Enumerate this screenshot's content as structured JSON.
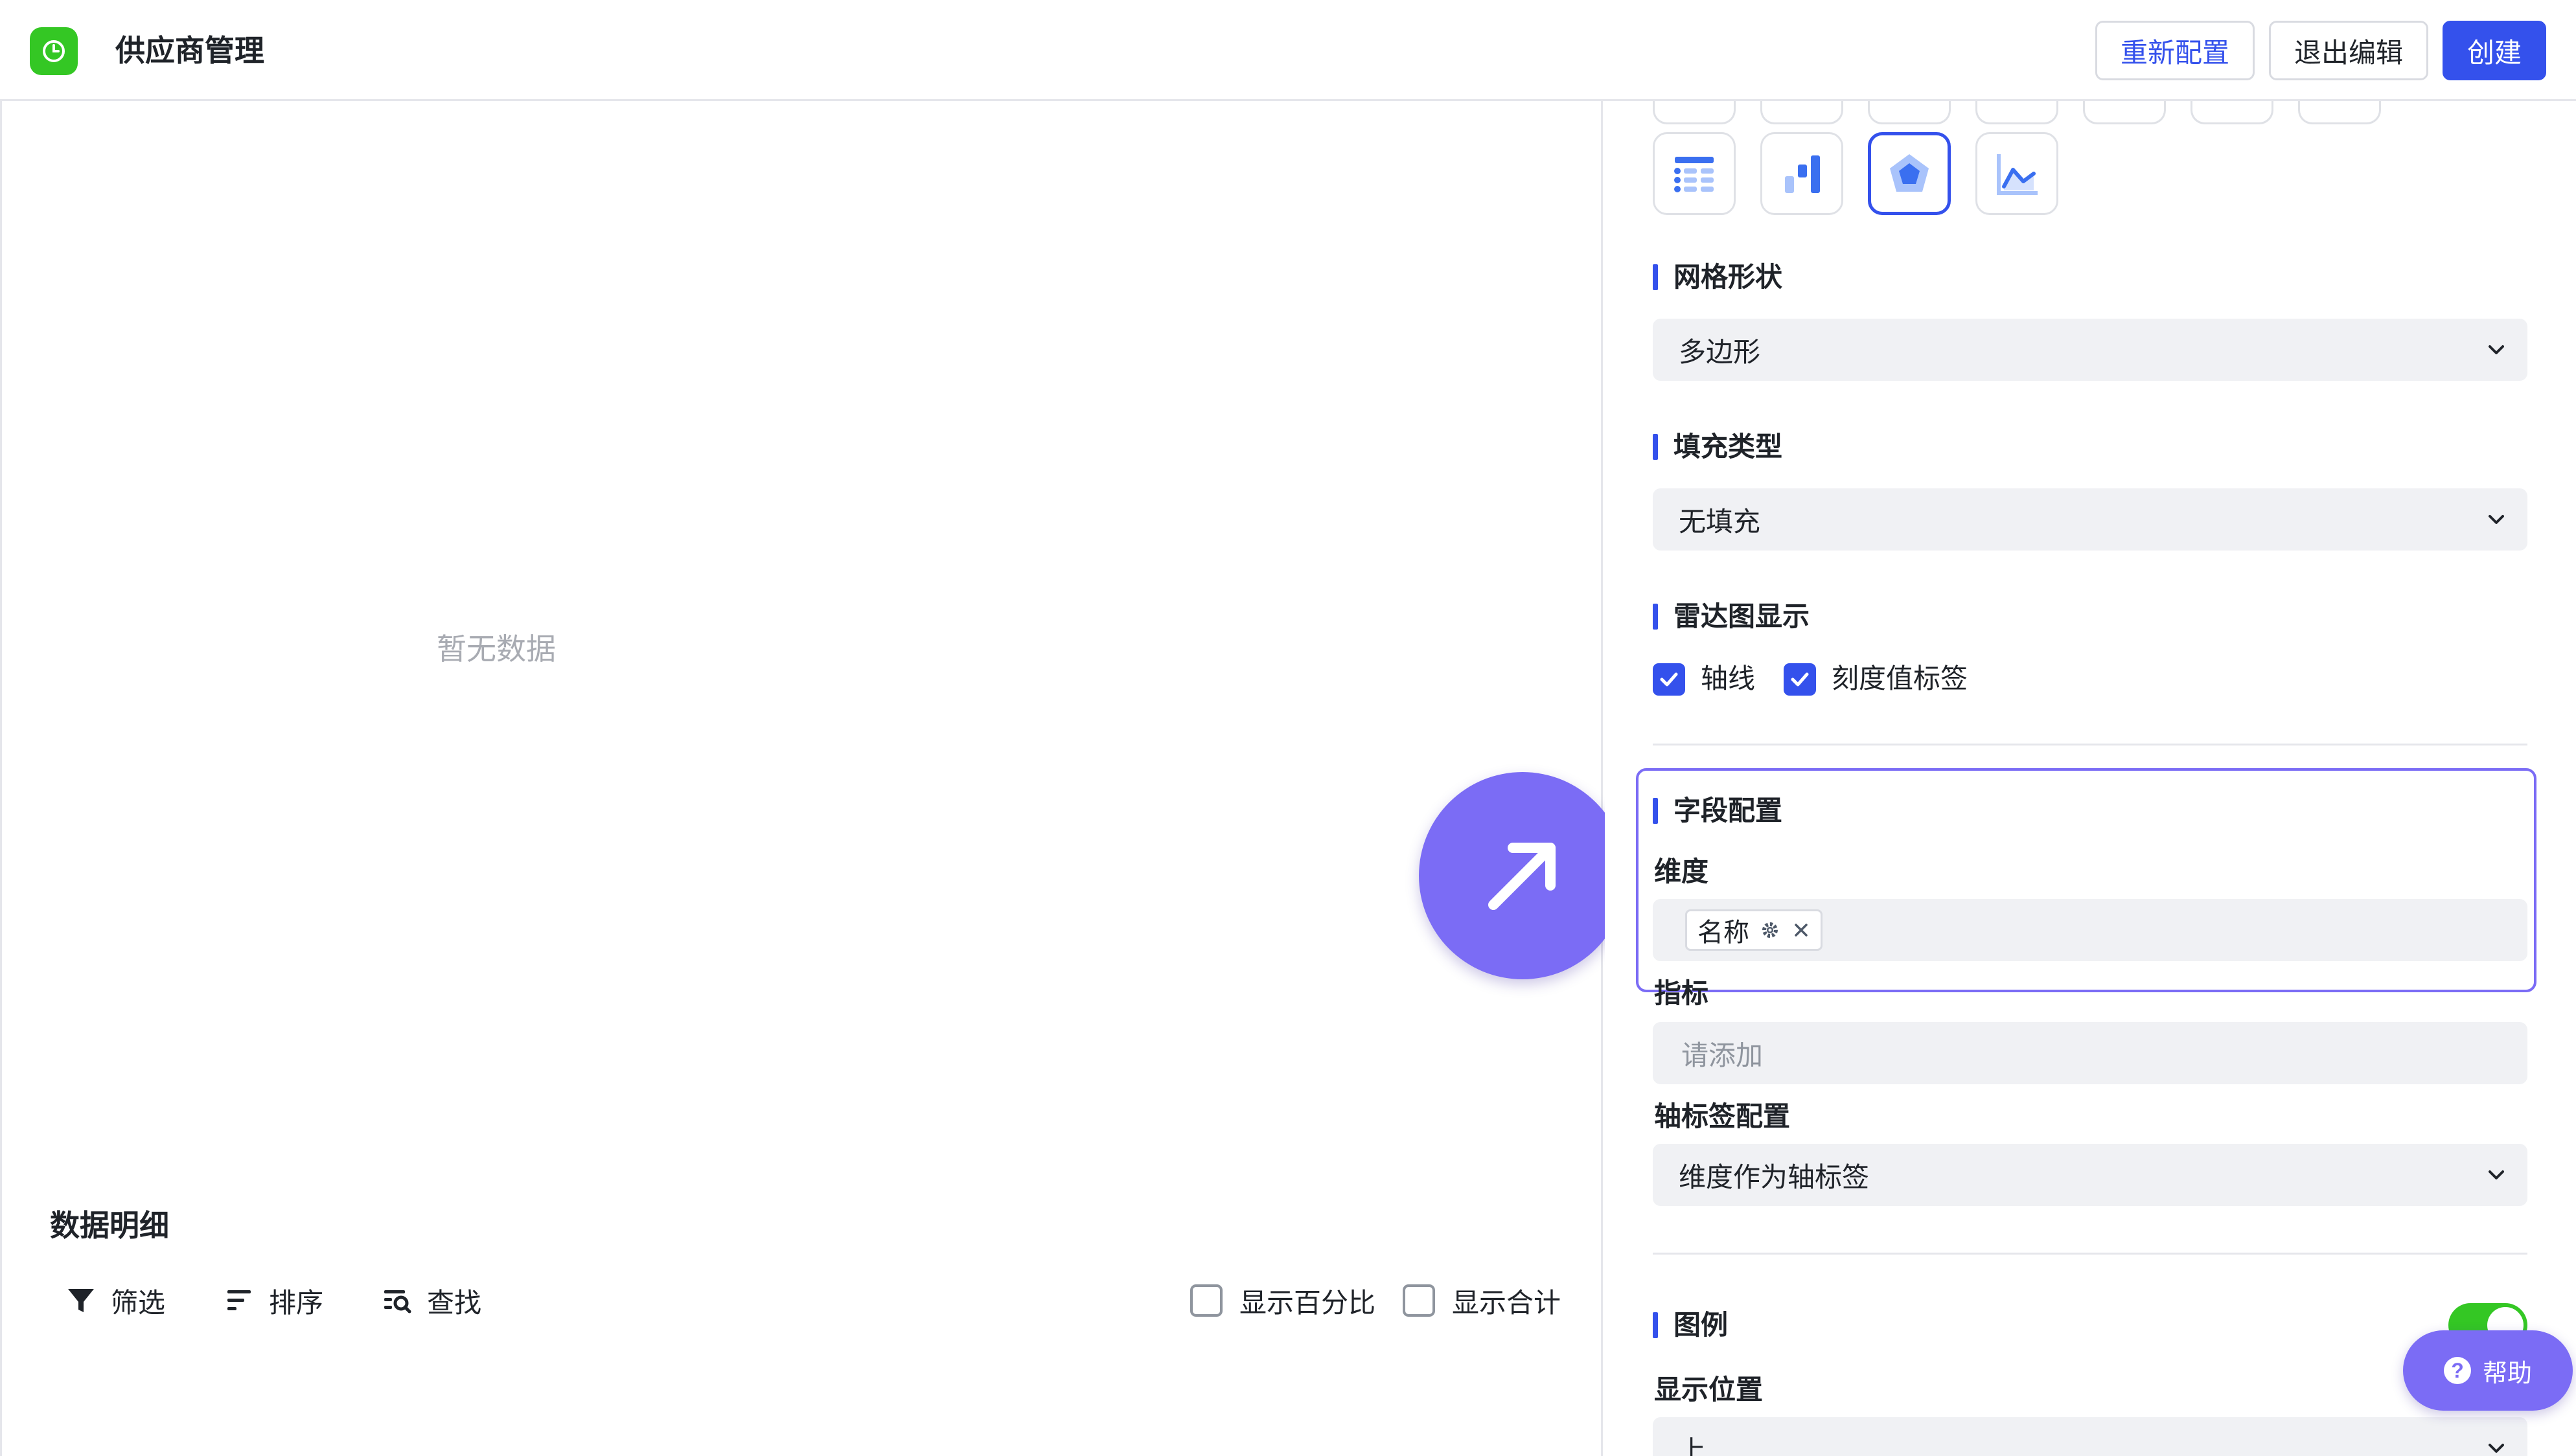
{
  "header": {
    "title": "供应商管理",
    "reconfigure_label": "重新配置",
    "exit_edit_label": "退出编辑",
    "create_label": "创建",
    "accent_color": "#3451ec",
    "logo_color": "#34c724"
  },
  "canvas": {
    "empty_text": "暂无数据"
  },
  "detail": {
    "title": "数据明细",
    "filter_label": "筛选",
    "sort_label": "排序",
    "search_label": "查找",
    "show_percent_label": "显示百分比",
    "show_total_label": "显示合计"
  },
  "panel": {
    "grid_shape": {
      "title": "网格形状",
      "value": "多边形"
    },
    "fill_type": {
      "title": "填充类型",
      "value": "无填充"
    },
    "radar_display": {
      "title": "雷达图显示",
      "axis_label": "轴线",
      "tick_label": "刻度值标签"
    },
    "field_config": {
      "title": "字段配置",
      "dimension_title": "维度",
      "dimension_tag": "名称",
      "metric_title": "指标",
      "metric_placeholder": "请添加",
      "axis_label_title": "轴标签配置",
      "axis_label_value": "维度作为轴标签"
    },
    "legend": {
      "title": "图例",
      "enabled": true,
      "position_title": "显示位置",
      "position_value": "上"
    }
  },
  "help": {
    "label": "帮助"
  }
}
